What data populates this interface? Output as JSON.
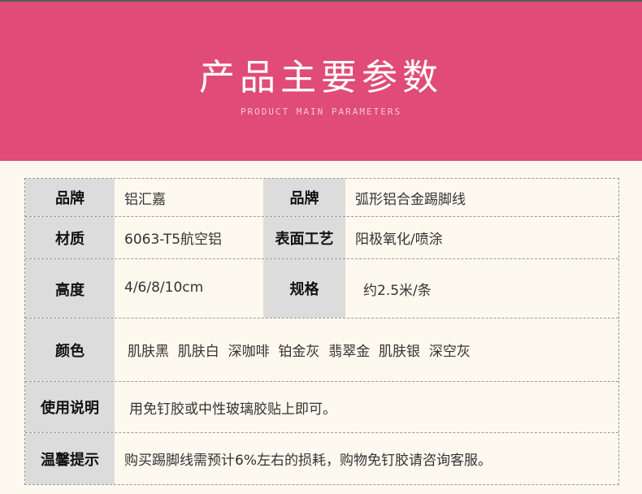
{
  "header": {
    "title": "产品主要参数",
    "subtitle": "PRODUCT MAIN PARAMETERS"
  },
  "params": {
    "brand_label": "品牌",
    "brand_value": "铝汇嘉",
    "product_label": "品牌",
    "product_value": "弧形铝合金踢脚线",
    "material_label": "材质",
    "material_value": "6063-T5航空铝",
    "surface_label": "表面工艺",
    "surface_value": "阳极氧化/喷涂",
    "height_label": "高度",
    "height_value": "4/6/8/10cm",
    "spec_label": "规格",
    "spec_value": "约2.5米/条",
    "color_label": "颜色",
    "color_value": "肌肤黑  肌肤白  深咖啡  铂金灰  翡翠金  肌肤银  深空灰",
    "usage_label": "使用说明",
    "usage_value": "用免钉胶或中性玻璃胶贴上即可。",
    "tip_label": "温馨提示",
    "tip_value": "购买踢脚线需预计6%左右的损耗，购物免钉胶请咨询客服。"
  },
  "colors": {
    "banner": "#e04b78",
    "label_bg": "#dcdcdc",
    "page_bg": "#fdf9ef"
  }
}
